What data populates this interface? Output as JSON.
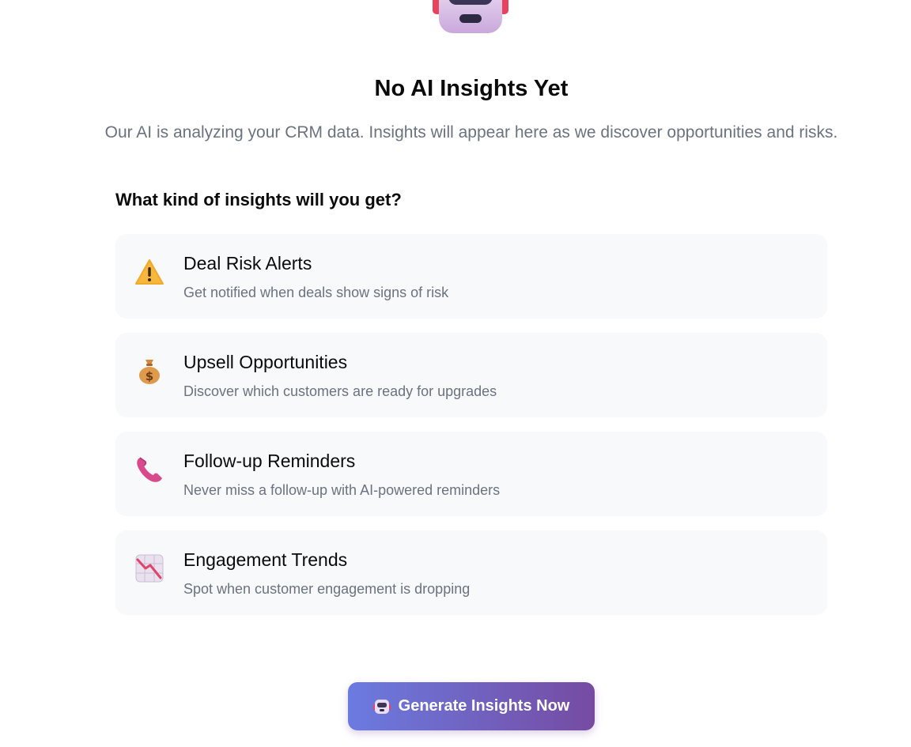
{
  "empty_state": {
    "hero_icon": "robot-icon",
    "title": "No AI Insights Yet",
    "subtitle": "Our AI is analyzing your CRM data. Insights will appear here as we discover opportunities and risks."
  },
  "insights_section": {
    "heading": "What kind of insights will you get?",
    "items": [
      {
        "icon": "warning-icon",
        "title": "Deal Risk Alerts",
        "description": "Get notified when deals show signs of risk"
      },
      {
        "icon": "money-bag-icon",
        "title": "Upsell Opportunities",
        "description": "Discover which customers are ready for upgrades"
      },
      {
        "icon": "telephone-icon",
        "title": "Follow-up Reminders",
        "description": "Never miss a follow-up with AI-powered reminders"
      },
      {
        "icon": "chart-decreasing-icon",
        "title": "Engagement Trends",
        "description": "Spot when customer engagement is dropping"
      }
    ]
  },
  "cta": {
    "icon": "robot-icon",
    "label": "Generate Insights Now"
  },
  "colors": {
    "button_gradient_start": "#6b7be0",
    "button_gradient_end": "#764ba2",
    "card_background": "#f8f9fb",
    "muted_text": "#6b7280"
  }
}
